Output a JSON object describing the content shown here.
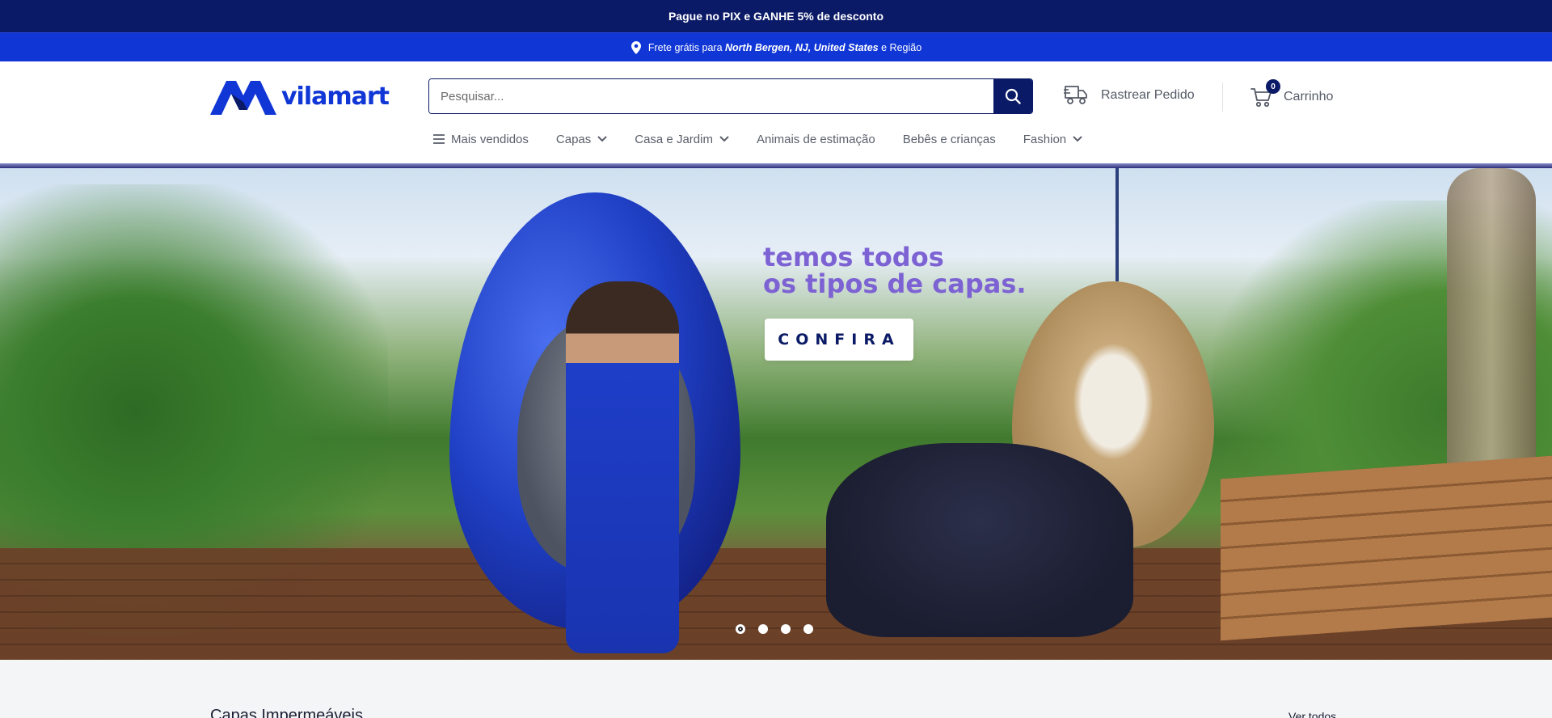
{
  "topbar": {
    "text": "Pague no PIX e GANHE 5% de desconto"
  },
  "shipbar": {
    "prefix": "Frete grátis para",
    "location": "North Bergen, NJ, United States",
    "suffix": "e Região",
    "icon": "location-pin-icon"
  },
  "header": {
    "logo_text": "vilamart",
    "search": {
      "placeholder": "Pesquisar...",
      "value": ""
    },
    "track_order": {
      "label": "Rastrear Pedido",
      "icon": "delivery-truck-icon"
    },
    "cart": {
      "label": "Carrinho",
      "count": "0",
      "icon": "shopping-cart-icon"
    }
  },
  "nav": {
    "items": [
      {
        "label": "Mais vendidos",
        "icon": "menu-icon"
      },
      {
        "label": "Capas",
        "dropdown": true
      },
      {
        "label": "Casa e Jardim",
        "dropdown": true
      },
      {
        "label": "Animais de estimação",
        "dropdown": false
      },
      {
        "label": "Bebês e crianças",
        "dropdown": false
      },
      {
        "label": "Fashion",
        "dropdown": true
      }
    ]
  },
  "hero": {
    "title_line1": "temos todos",
    "title_line2": "os tipos de capas.",
    "cta": "CONFIRA",
    "slides": 4,
    "active_slide": 1
  },
  "section": {
    "title": "Capas Impermeáveis",
    "link": "Ver todos"
  },
  "colors": {
    "navy": "#0b1a66",
    "blue": "#1036d6",
    "purple": "#7d62d4"
  }
}
